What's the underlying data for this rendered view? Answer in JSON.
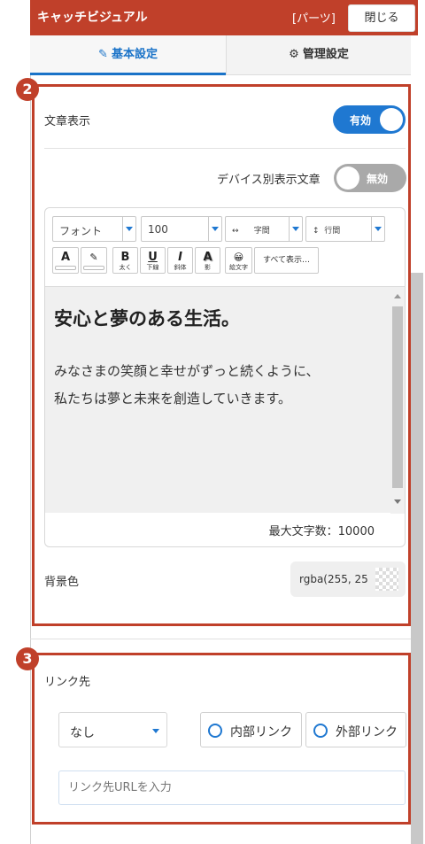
{
  "header": {
    "title": "キャッチビジュアル",
    "tag": "[パーツ]",
    "close_label": "閉じる"
  },
  "tabs": [
    {
      "label": "基本設定",
      "icon": "edit-icon",
      "active": true
    },
    {
      "label": "管理設定",
      "icon": "gear-icon",
      "active": false
    }
  ],
  "markers": {
    "first": "2",
    "second": "3"
  },
  "text_display": {
    "label": "文章表示",
    "toggle_label": "有効",
    "state": "on"
  },
  "device_text": {
    "label": "デバイス別表示文章",
    "toggle_label": "無効",
    "state": "off"
  },
  "toolbar": {
    "font": "フォント",
    "size": "100",
    "letter_spacing": "字間",
    "line_height": "行間",
    "letter_spacing_icon": "↔",
    "line_height_icon": "↕",
    "text_color_glyph": "A",
    "highlight_glyph": "✎",
    "bold_glyph": "B",
    "bold_label": "太く",
    "underline_glyph": "U",
    "underline_label": "下線",
    "italic_glyph": "I",
    "italic_label": "斜体",
    "shadow_glyph": "A",
    "shadow_label": "影",
    "emoji_glyph": "😀",
    "emoji_label": "絵文字",
    "show_all_label": "すべて表示…"
  },
  "editor": {
    "heading": "安心と夢のある生活。",
    "body_line1": "みなさまの笑顔と幸せがずっと続くように、",
    "body_line2": "私たちは夢と未来を創造していきます。",
    "max_chars": "最大文字数：10000"
  },
  "background": {
    "label": "背景色",
    "value": "rgba(255, 25"
  },
  "link": {
    "label": "リンク先",
    "select_value": "なし",
    "internal_label": "内部リンク",
    "external_label": "外部リンク",
    "url_placeholder": "リンク先URLを入力"
  },
  "colors": {
    "accent": "#c0402a",
    "primary": "#1f78d1"
  }
}
